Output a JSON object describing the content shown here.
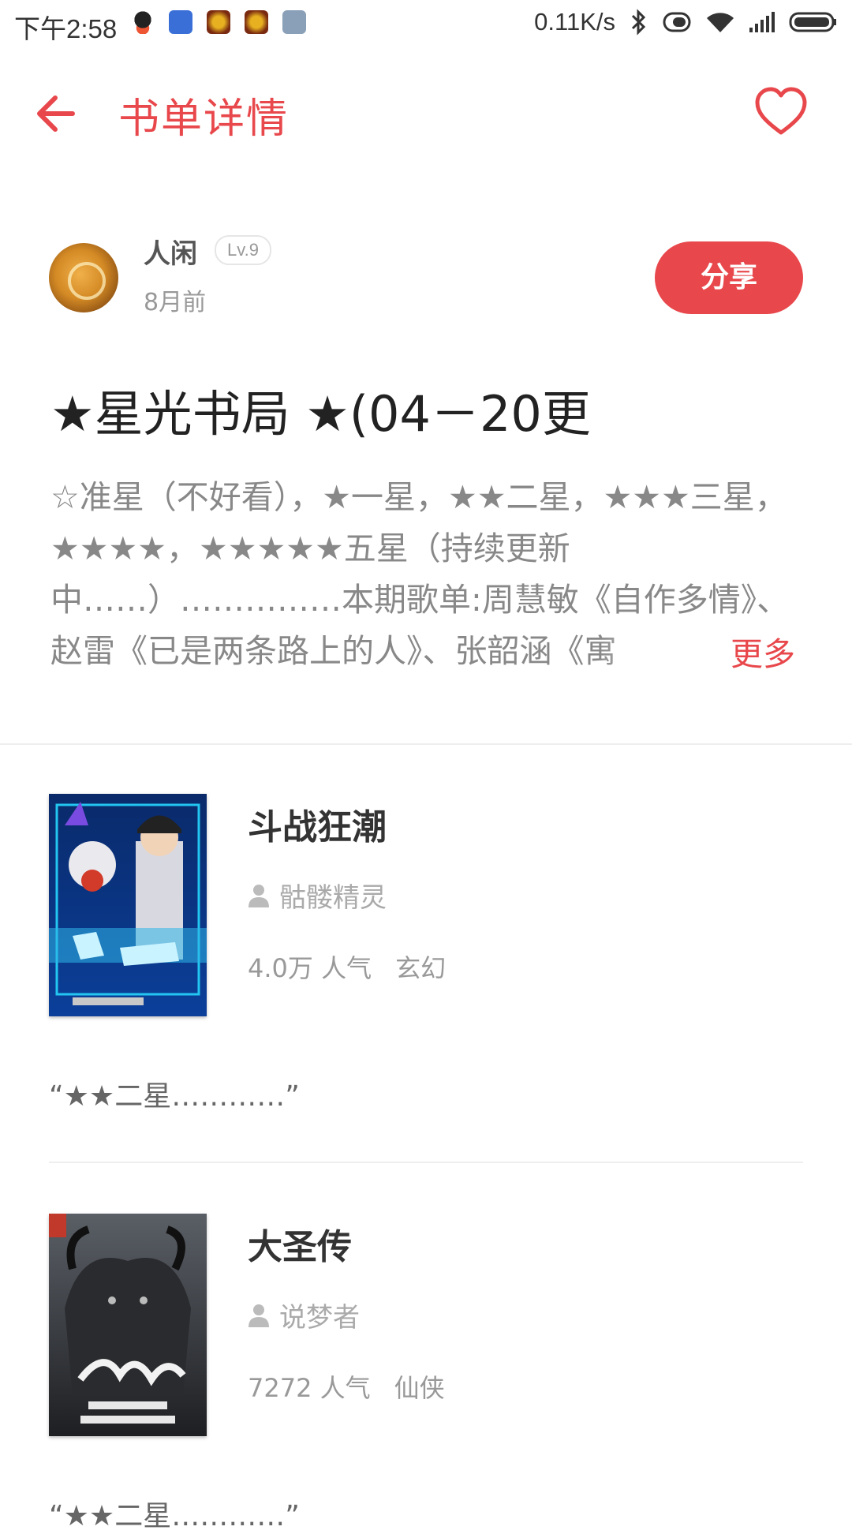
{
  "status_bar": {
    "time": "下午2:58",
    "speed": "0.11K/s",
    "app_icons": [
      "qq-icon",
      "flag-app-icon",
      "game-app-icon",
      "game-app-icon",
      "calculator-app-icon"
    ],
    "status_icons": [
      "bluetooth-icon",
      "vibrate-icon",
      "wifi-icon",
      "signal-icon",
      "battery-icon"
    ]
  },
  "header": {
    "title": "书单详情"
  },
  "author": {
    "name": "人闲",
    "level": "Lv.9",
    "time": "8月前",
    "share_label": "分享"
  },
  "booklist": {
    "title": "★星光书局 ★(04－20更",
    "description": "☆准星（不好看），★一星，★★二星，★★★三星，★★★★，★★★★★五星（持续更新中……）……………本期歌单:周慧敏《自作多情》、赵雷《已是两条路上的人》、张韶涵《寓",
    "more_label": "更多"
  },
  "books": [
    {
      "title": "斗战狂潮",
      "author": "骷髅精灵",
      "popularity": "4.0万 人气",
      "genre": "玄幻",
      "quote": "“★★二星…………”"
    },
    {
      "title": "大圣传",
      "author": "说梦者",
      "popularity": "7272 人气",
      "genre": "仙侠",
      "quote": "“★★二星…………”"
    }
  ],
  "colors": {
    "accent": "#e8474b",
    "text_dark": "#222222",
    "text_muted": "#888888"
  }
}
